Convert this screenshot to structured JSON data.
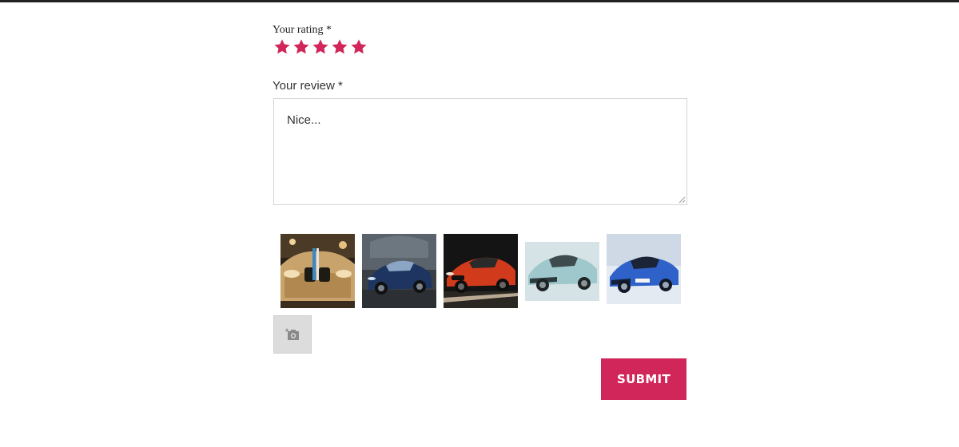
{
  "rating": {
    "label": "Your rating *",
    "value": 5,
    "max": 5,
    "star_color": "#d1265a"
  },
  "review": {
    "label": "Your review *",
    "text": "Nice..."
  },
  "photos": [
    {
      "name": "gold-bmw-photo"
    },
    {
      "name": "dark-blue-bmw-photo"
    },
    {
      "name": "red-bmw-photo"
    },
    {
      "name": "silver-bmw-i8-photo"
    },
    {
      "name": "blue-bmw-i8-photo"
    }
  ],
  "upload": {
    "icon": "camera-plus-icon"
  },
  "submit": {
    "label": "SUBMIT",
    "color": "#d1265a"
  }
}
